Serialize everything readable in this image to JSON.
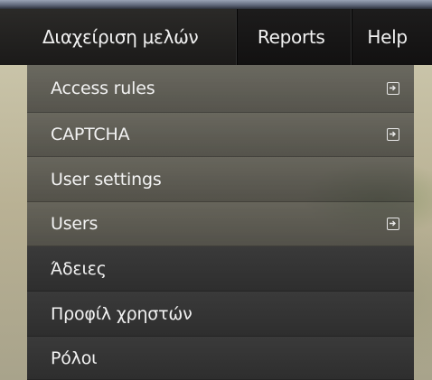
{
  "navbar": {
    "items": [
      {
        "label": "Διαχείριση μελών"
      },
      {
        "label": "Reports"
      },
      {
        "label": "Help"
      }
    ]
  },
  "dropdown": {
    "items": [
      {
        "label": "Access rules",
        "has_submenu": true
      },
      {
        "label": "CAPTCHA",
        "has_submenu": true
      },
      {
        "label": "User settings",
        "has_submenu": false
      },
      {
        "label": "Users",
        "has_submenu": true
      },
      {
        "label": "Άδειες",
        "has_submenu": false
      },
      {
        "label": "Προφίλ χρηστών",
        "has_submenu": false
      },
      {
        "label": "Ρόλοι",
        "has_submenu": false
      }
    ],
    "submenu_icon": "arrow-right-box-icon"
  },
  "colors": {
    "navbar_bg": "#141313",
    "menu_text": "#f2f2f2",
    "menu_dark_bg": "#333333"
  }
}
